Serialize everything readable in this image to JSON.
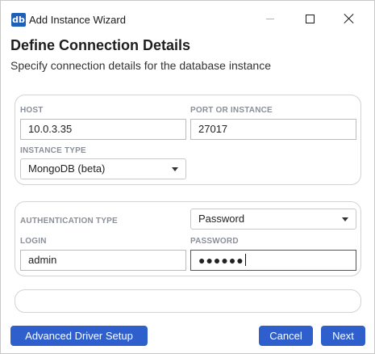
{
  "window": {
    "app_icon": "db",
    "title": "Add Instance Wizard"
  },
  "header": {
    "title": "Define Connection Details",
    "subtitle": "Specify connection details for the database instance"
  },
  "connection": {
    "host_label": "HOST",
    "host_value": "10.0.3.35",
    "port_label": "PORT OR INSTANCE",
    "port_value": "27017",
    "instance_type_label": "INSTANCE TYPE",
    "instance_type_value": "MongoDB (beta)"
  },
  "authentication": {
    "auth_type_label": "AUTHENTICATION TYPE",
    "auth_type_value": "Password",
    "login_label": "LOGIN",
    "login_value": "admin",
    "password_label": "PASSWORD",
    "password_masked": "●●●●●●"
  },
  "footer": {
    "advanced_label": "Advanced Driver Setup",
    "cancel_label": "Cancel",
    "next_label": "Next"
  },
  "colors": {
    "accent": "#2f5fcc",
    "app_icon_bg": "#1e5fb7",
    "label": "#8a8f98"
  }
}
